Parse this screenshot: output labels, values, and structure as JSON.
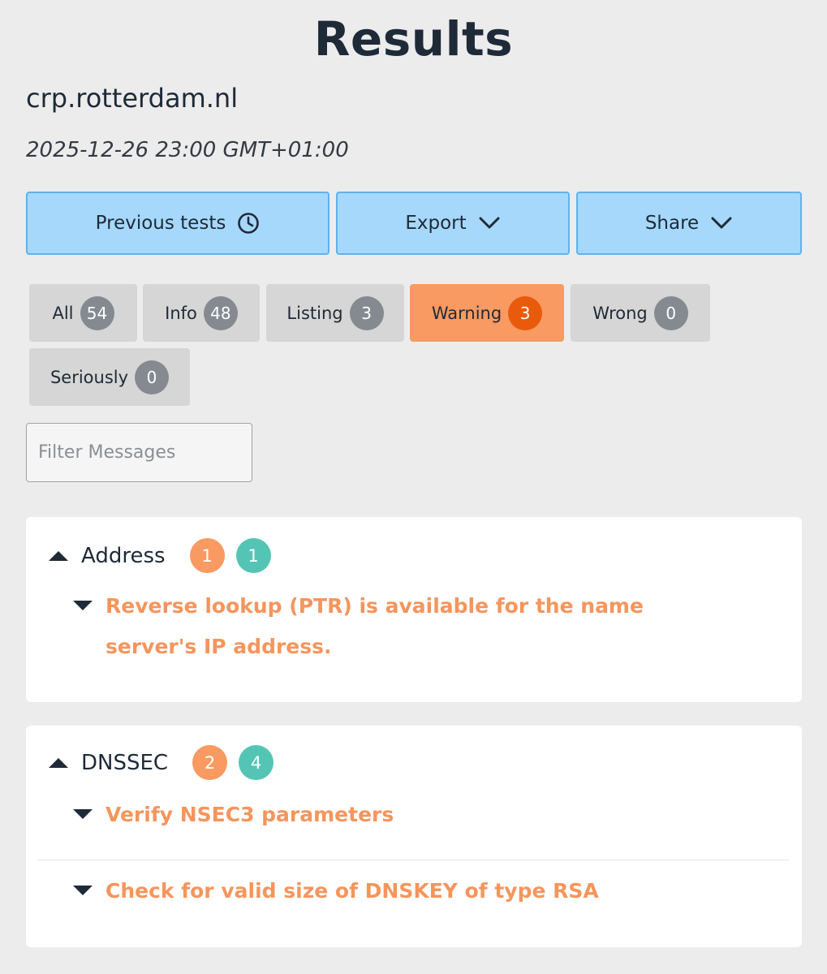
{
  "page_title": "Results",
  "domain": "crp.rotterdam.nl",
  "test_time": "2025-12-26 23:00 GMT+01:00",
  "actions": {
    "previous_tests": "Previous tests",
    "export": "Export",
    "share": "Share"
  },
  "filters": [
    {
      "label": "All",
      "count": "54"
    },
    {
      "label": "Info",
      "count": "48"
    },
    {
      "label": "Listing",
      "count": "3"
    },
    {
      "label": "Warning",
      "count": "3"
    },
    {
      "label": "Wrong",
      "count": "0"
    },
    {
      "label": "Seriously",
      "count": "0"
    }
  ],
  "search": {
    "placeholder": "Filter Messages"
  },
  "colors": {
    "warning": "#f89a62",
    "notice": "#54c5b4",
    "action_button": "#a6d8fb"
  },
  "sections": [
    {
      "title": "Address",
      "warning_count": "1",
      "notice_count": "1",
      "messages": [
        "Reverse lookup (PTR) is available for the name server's IP address."
      ]
    },
    {
      "title": "DNSSEC",
      "warning_count": "2",
      "notice_count": "4",
      "messages": [
        "Verify NSEC3 parameters",
        "Check for valid size of DNSKEY of type RSA"
      ]
    }
  ]
}
